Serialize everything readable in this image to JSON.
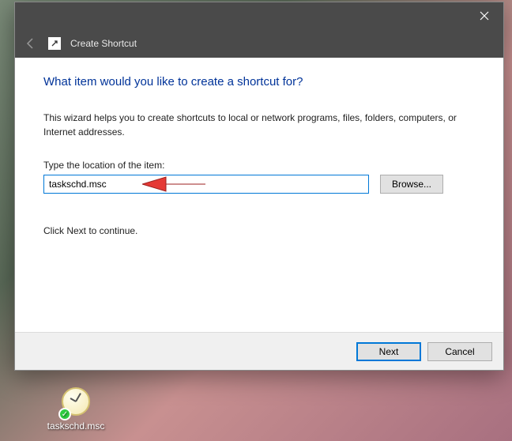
{
  "dialog": {
    "title": "Create Shortcut",
    "heading": "What item would you like to create a shortcut for?",
    "description": "This wizard helps you to create shortcuts to local or network programs, files, folders, computers, or Internet addresses.",
    "input_label": "Type the location of the item:",
    "input_value": "taskschd.msc",
    "browse_label": "Browse...",
    "instruction": "Click Next to continue.",
    "next_label": "Next",
    "cancel_label": "Cancel"
  },
  "desktop": {
    "shortcut_name": "taskschd.msc"
  }
}
